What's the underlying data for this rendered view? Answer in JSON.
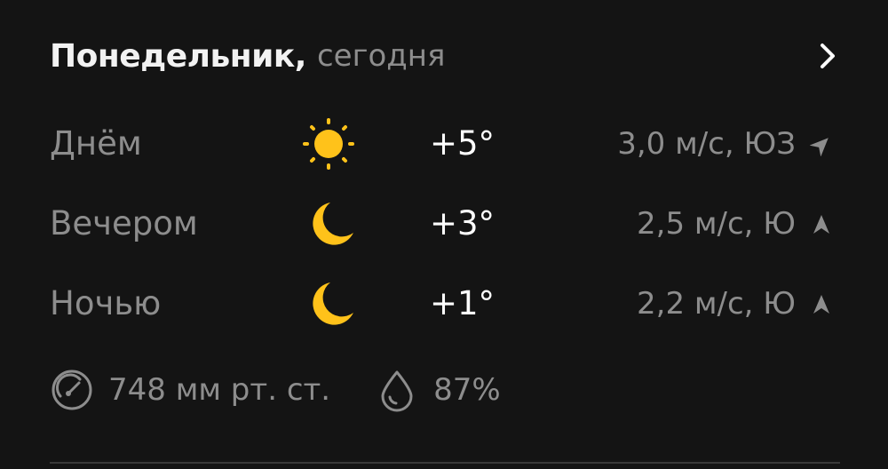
{
  "header": {
    "day_name": "Понедельник,",
    "day_sub": "сегодня"
  },
  "periods": [
    {
      "label": "Днём",
      "icon": "sun-icon",
      "temp": "+5°",
      "wind": "3,0 м/с, ЮЗ",
      "wind_dir": "ЮЗ"
    },
    {
      "label": "Вечером",
      "icon": "moon-icon",
      "temp": "+3°",
      "wind": "2,5 м/с, Ю",
      "wind_dir": "Ю"
    },
    {
      "label": "Ночью",
      "icon": "moon-icon",
      "temp": "+1°",
      "wind": "2,2 м/с, Ю",
      "wind_dir": "Ю"
    }
  ],
  "details": {
    "pressure": "748 мм рт. ст.",
    "humidity": "87%"
  },
  "colors": {
    "background": "#141414",
    "primary_text": "#ffffff",
    "secondary_text": "#8d8d8d",
    "sun": "#ffc21a",
    "moon": "#ffc21a"
  }
}
